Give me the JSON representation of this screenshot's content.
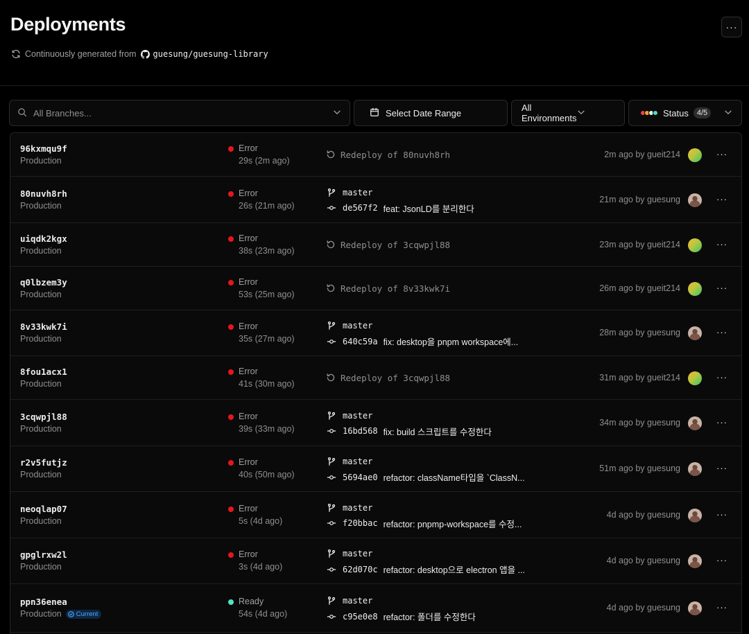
{
  "header": {
    "title": "Deployments",
    "subtitle_prefix": "Continuously generated from",
    "repo": "guesung/guesung-library",
    "more_label": "···"
  },
  "filters": {
    "branch_placeholder": "All Branches...",
    "date_label": "Select Date Range",
    "environment_label": "All Environments",
    "status_label": "Status",
    "status_count": "4/5",
    "status_colors": [
      "#e5484d",
      "#f5a524",
      "#ededed",
      "#45dec5"
    ]
  },
  "colors": {
    "error": "#e5171d",
    "ready": "#50e3c2"
  },
  "deployments": [
    {
      "id": "96kxmqu9f",
      "env": "Production",
      "status": "Error",
      "duration": "29s (2m ago)",
      "type": "redeploy",
      "redeploy_text": "Redeploy of 80nuvh8rh",
      "meta": "2m ago by gueit214",
      "avatar": "gradient"
    },
    {
      "id": "80nuvh8rh",
      "env": "Production",
      "status": "Error",
      "duration": "26s (21m ago)",
      "type": "commit",
      "branch": "master",
      "sha": "de567f2",
      "message": "feat: JsonLD를 분리한다",
      "meta": "21m ago by guesung",
      "avatar": "photo"
    },
    {
      "id": "uiqdk2kgx",
      "env": "Production",
      "status": "Error",
      "duration": "38s (23m ago)",
      "type": "redeploy",
      "redeploy_text": "Redeploy of 3cqwpjl88",
      "meta": "23m ago by gueit214",
      "avatar": "gradient"
    },
    {
      "id": "q0lbzem3y",
      "env": "Production",
      "status": "Error",
      "duration": "53s (25m ago)",
      "type": "redeploy",
      "redeploy_text": "Redeploy of 8v33kwk7i",
      "meta": "26m ago by gueit214",
      "avatar": "gradient"
    },
    {
      "id": "8v33kwk7i",
      "env": "Production",
      "status": "Error",
      "duration": "35s (27m ago)",
      "type": "commit",
      "branch": "master",
      "sha": "640c59a",
      "message": "fix: desktop을 pnpm workspace에...",
      "meta": "28m ago by guesung",
      "avatar": "photo"
    },
    {
      "id": "8fou1acx1",
      "env": "Production",
      "status": "Error",
      "duration": "41s (30m ago)",
      "type": "redeploy",
      "redeploy_text": "Redeploy of 3cqwpjl88",
      "meta": "31m ago by gueit214",
      "avatar": "gradient"
    },
    {
      "id": "3cqwpjl88",
      "env": "Production",
      "status": "Error",
      "duration": "39s (33m ago)",
      "type": "commit",
      "branch": "master",
      "sha": "16bd568",
      "message": "fix: build 스크립트를 수정한다",
      "meta": "34m ago by guesung",
      "avatar": "photo"
    },
    {
      "id": "r2v5futjz",
      "env": "Production",
      "status": "Error",
      "duration": "40s (50m ago)",
      "type": "commit",
      "branch": "master",
      "sha": "5694ae0",
      "message": "refactor: className타입을 `ClassN...",
      "meta": "51m ago by guesung",
      "avatar": "photo"
    },
    {
      "id": "neoqlap07",
      "env": "Production",
      "status": "Error",
      "duration": "5s (4d ago)",
      "type": "commit",
      "branch": "master",
      "sha": "f20bbac",
      "message": "refactor: pnpmp-workspace를 수정...",
      "meta": "4d ago by guesung",
      "avatar": "photo"
    },
    {
      "id": "gpglrxw2l",
      "env": "Production",
      "status": "Error",
      "duration": "3s (4d ago)",
      "type": "commit",
      "branch": "master",
      "sha": "62d070c",
      "message": "refactor: desktop으로 electron 앱을 ...",
      "meta": "4d ago by guesung",
      "avatar": "photo"
    },
    {
      "id": "ppn36enea",
      "env": "Production",
      "status": "Ready",
      "duration": "54s (4d ago)",
      "type": "commit",
      "branch": "master",
      "sha": "c95e0e8",
      "message": "refactor: 폴더를 수정한다",
      "meta": "4d ago by guesung",
      "avatar": "photo",
      "badge": "Current"
    }
  ]
}
